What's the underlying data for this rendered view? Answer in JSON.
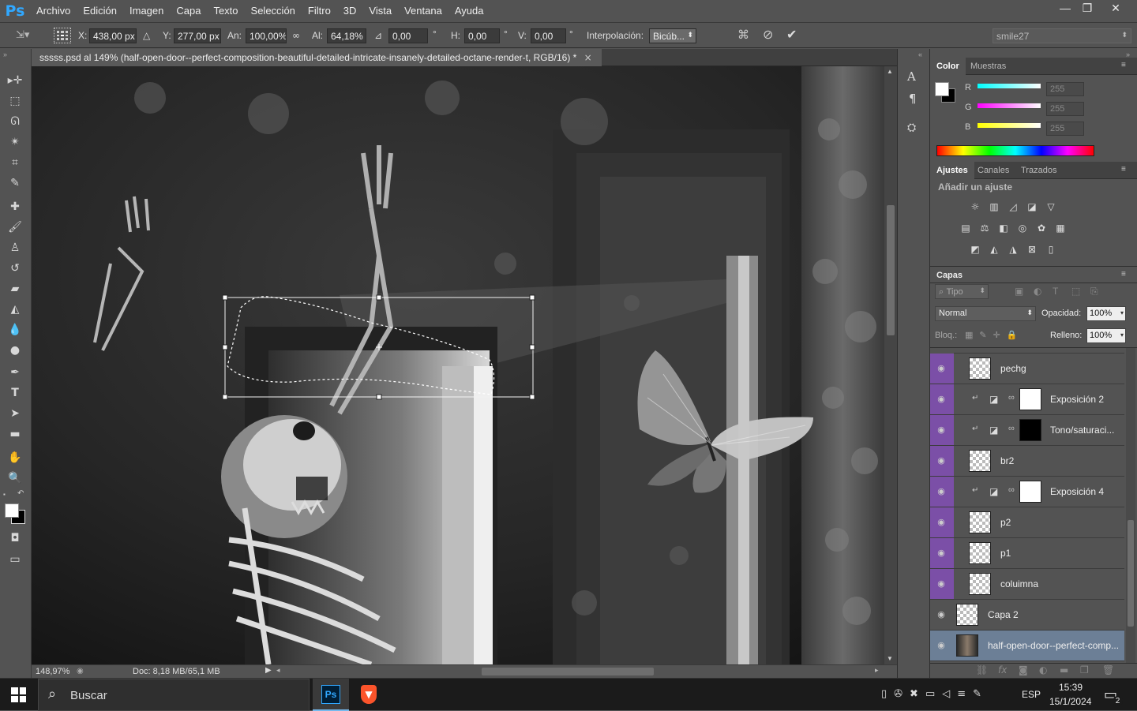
{
  "app": {
    "logo": "Ps"
  },
  "menu": [
    "Archivo",
    "Edición",
    "Imagen",
    "Capa",
    "Texto",
    "Selección",
    "Filtro",
    "3D",
    "Vista",
    "Ventana",
    "Ayuda"
  ],
  "window_buttons": {
    "minimize": "—",
    "restore": "❐",
    "close": "✕"
  },
  "options": {
    "x_label": "X:",
    "x_value": "438,00 px",
    "y_label": "Y:",
    "y_value": "277,00 px",
    "w_label": "An:",
    "w_value": "100,00%",
    "h_label": "Al:",
    "h_value": "64,18%",
    "angle_value": "0,00",
    "deg": "°",
    "hskew_label": "H:",
    "hskew_value": "0,00",
    "vskew_label": "V:",
    "vskew_value": "0,00",
    "interp_label": "Interpolación:",
    "interp_value": "Bicúb...",
    "workspace": "smile27"
  },
  "document": {
    "tab_title": "sssss.psd al 149% (half-open-door--perfect-composition-beautiful-detailed-intricate-insanely-detailed-octane-render-t, RGB/16) *",
    "zoom": "148,97%",
    "doc_info": "Doc: 8,18 MB/65,1 MB"
  },
  "color_panel": {
    "tabs": [
      "Color",
      "Muestras"
    ],
    "r_label": "R",
    "g_label": "G",
    "b_label": "B",
    "r_value": "255",
    "g_value": "255",
    "b_value": "255"
  },
  "adjust_panel": {
    "tabs": [
      "Ajustes",
      "Canales",
      "Trazados"
    ],
    "heading": "Añadir un ajuste"
  },
  "layers_panel": {
    "title": "Capas",
    "filter_label": "Tipo",
    "blend_mode": "Normal",
    "opacity_label": "Opacidad:",
    "opacity_value": "100%",
    "lock_label": "Bloq.:",
    "fill_label": "Relleno:",
    "fill_value": "100%",
    "layers": [
      {
        "name": "pechg",
        "kind": "pixel",
        "group": true
      },
      {
        "name": "Exposición 2",
        "kind": "adjust",
        "mask": "white",
        "group": true
      },
      {
        "name": "Tono/saturaci...",
        "kind": "adjust",
        "mask": "black",
        "group": true
      },
      {
        "name": "br2",
        "kind": "pixel",
        "group": true
      },
      {
        "name": "Exposición 4",
        "kind": "adjust",
        "mask": "white",
        "group": true
      },
      {
        "name": "p2",
        "kind": "pixel",
        "group": true
      },
      {
        "name": "p1",
        "kind": "pixel",
        "group": true
      },
      {
        "name": "coluimna",
        "kind": "pixel",
        "group": true
      },
      {
        "name": "Capa 2",
        "kind": "pixel",
        "group": false
      },
      {
        "name": "half-open-door--perfect-comp...",
        "kind": "image",
        "group": false,
        "selected": true
      }
    ]
  },
  "taskbar": {
    "search": "Buscar",
    "lang": "ESP",
    "time": "15:39",
    "date": "15/1/2024",
    "notifications": "2"
  }
}
